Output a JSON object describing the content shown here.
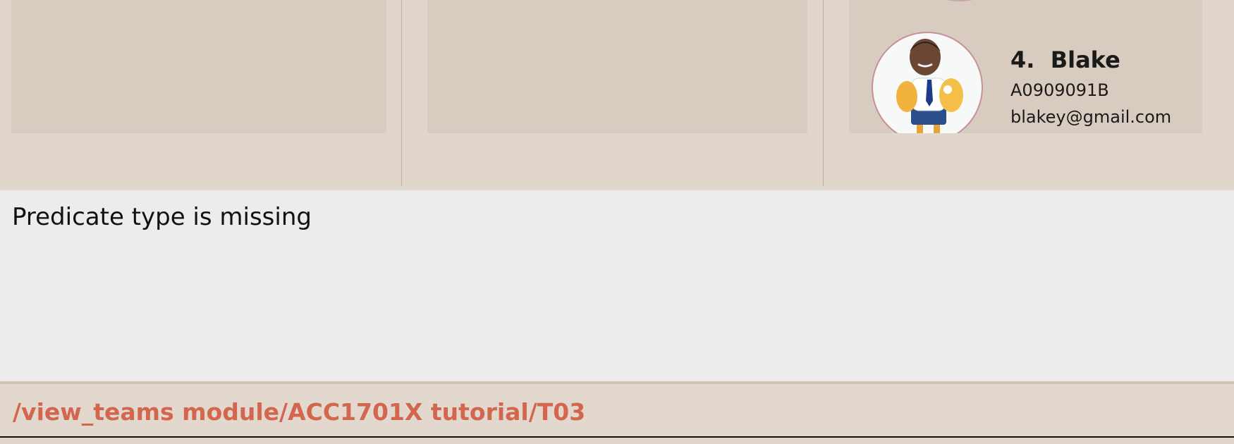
{
  "team_panels": {
    "visible_member": {
      "index_name": "4.  Blake",
      "student_id": "A0909091B",
      "email": "blakey@gmail.com",
      "avatar_icon": "person-avatar"
    }
  },
  "result_display": {
    "message": "Predicate type is missing"
  },
  "command_box": {
    "value": "/view_teams module/ACC1701X tutorial/T03"
  },
  "colors": {
    "panel_bg": "#e1d6cc",
    "card_bg": "#d8cbbf",
    "result_bg": "#ececec",
    "command_text": "#d3664f"
  }
}
